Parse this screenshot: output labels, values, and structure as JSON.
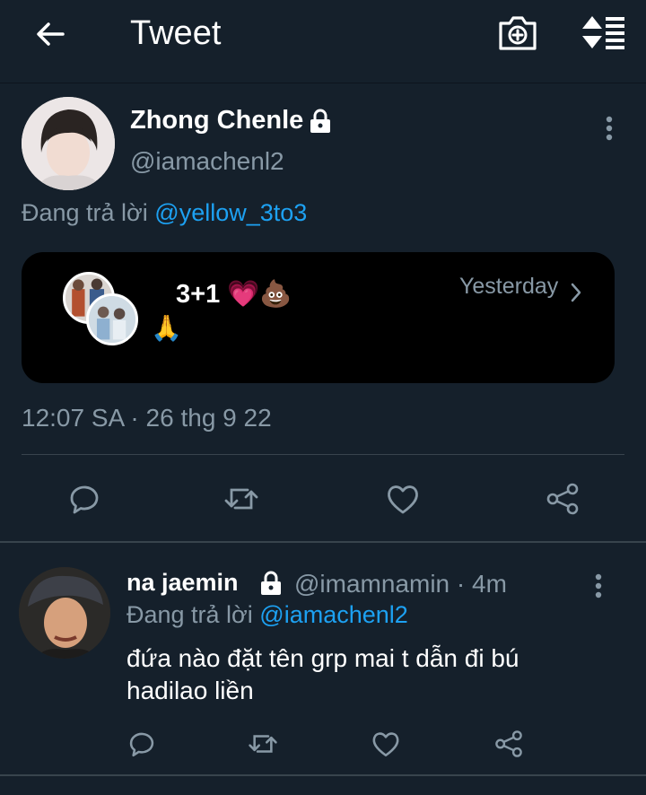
{
  "header": {
    "title": "Tweet",
    "back_icon": "arrow-left-icon",
    "camera_icon": "camera-plus-icon",
    "sort_icon": "sort-icon"
  },
  "main_tweet": {
    "author_name": "Zhong Chenle",
    "author_handle": "@iamachenl2",
    "replying_prefix": "Đang trả lời",
    "replying_to": "@yellow_3to3",
    "card": {
      "title": "3+1 💗💩",
      "subtitle": "🙏",
      "time": "Yesterday"
    },
    "timestamp": "12:07 SA · 26 thg 9 22"
  },
  "reply_tweet": {
    "author_name": "na jaemin",
    "author_handle": "@imamnamin · 4m",
    "replying_prefix": "Đang trả lời",
    "replying_to": "@iamachenl2",
    "text": "đứa nào đặt tên grp mai t dẫn đi bú hadilao liền"
  },
  "colors": {
    "background": "#15202b",
    "accent": "#1da1f2",
    "muted": "#8899a6",
    "divider": "#38444d"
  }
}
